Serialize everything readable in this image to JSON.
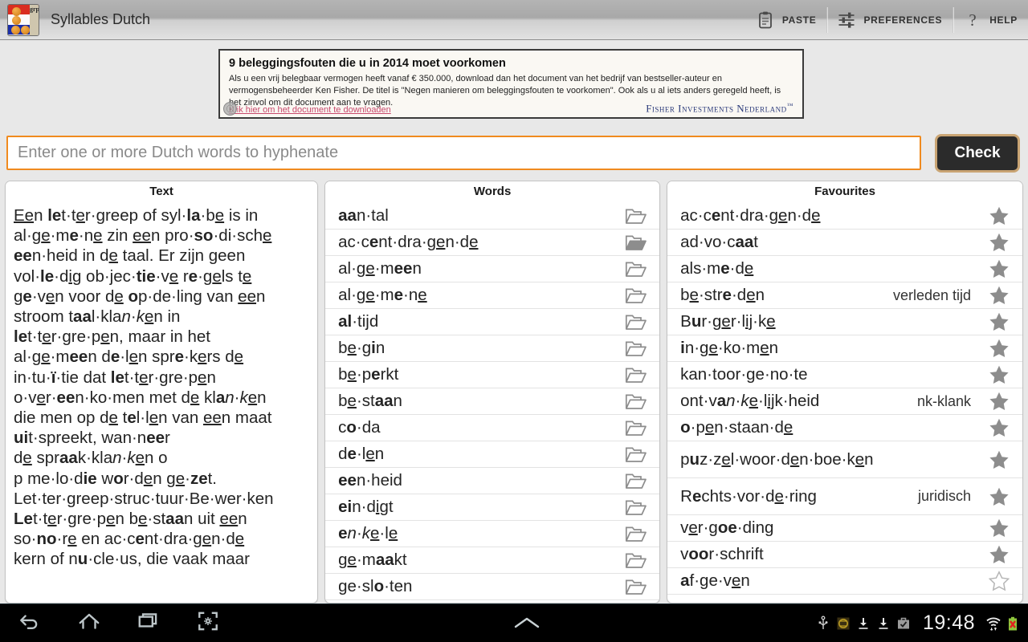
{
  "app": {
    "title": "Syllables Dutch",
    "logo_icon": "dutch-flag-balls-icon",
    "logo_letters": "grpn"
  },
  "actionbar": {
    "items": [
      {
        "label": "PASTE",
        "icon": "clipboard-paste-icon"
      },
      {
        "label": "PREFERENCES",
        "icon": "sliders-settings-icon"
      },
      {
        "label": "HELP",
        "icon": "question-mark-icon"
      }
    ]
  },
  "ad": {
    "title": "9 beleggingsfouten die u in 2014 moet voorkomen",
    "body": "Als u een vrij belegbaar vermogen heeft vanaf € 350.000, download dan het document van het bedrijf van bestseller-auteur en vermogensbeheerder Ken Fisher. De titel is \"Negen manieren om beleggingsfouten te voorkomen\". Ook als u al iets anders geregeld heeft, is het zinvol om dit document aan te vragen.",
    "link": "Klik hier om het document te downloaden",
    "brand": "Fisher Investments Nederland",
    "brand_tm": "™",
    "adchoices_icon": "adchoices-icon"
  },
  "search": {
    "placeholder": "Enter one or more Dutch words to hyphenate",
    "value": "",
    "accent_color": "#f08a1e"
  },
  "check_button": {
    "label": "Check"
  },
  "panels": {
    "text": {
      "title": "Text",
      "lines": [
        "<u>Ee</u>n <b>le</b>t·t<u>e</u>r·greep of syl·<b>la</b>·b<u>e</u> is in",
        "al·g<u>e</u>·m<b>e</b>·n<u>e</u> zin <u>ee</u>n pro·<b>so</b>·di·sch<u>e</u>",
        "<b>ee</b>n·heid in d<u>e</u> taal. Er zijn geen",
        "vol·<b>le</b>·d<u>i</u>g ob·jec·<b>tie</b>·v<u>e</u> r<b>e</b>·g<u>e</u>ls t<u>e</u>",
        "g<b>e</b>·v<u>e</u>n voor d<u>e</u> <b>o</b>p·de·ling van <u>ee</u>n",
        "stroom t<b>aa</b>l·kla<i>n</i>·<i>k</i><u>e</u>n in",
        "<b>le</b>t·t<u>e</u>r·gre·p<u>e</u>n, maar in het",
        "al·g<u>e</u>·m<b>ee</b>n d<b>e</b>·l<u>e</u>n spr<b>e</b>·k<u>e</u>rs d<u>e</u>",
        "in·tu·<b>ï</b>·tie dat <b>le</b>t·t<u>e</u>r·gre·p<u>e</u>n",
        "o·v<u>e</u>r·<b>ee</b>n·ko·men met d<u>e</u> kl<b>a</b><i>n</i>·<i>k</i><u>e</u>n",
        "die men op d<u>e</u> t<b>e</b>l·l<u>e</u>n van <u>ee</u>n maat",
        "<b>ui</b>t·spreekt, wan·n<b>ee</b>r",
        "d<u>e</u> spr<b>aa</b>k·kla<i>n</i>·<i>k</i><u>e</u>n o",
        "p me·lo·d<b>ie</b> w<b>o</b>r·d<u>e</u>n g<u>e</u>·<b>ze</b>t.",
        "Let·ter·greep·struc·tuur·Be·wer·ken",
        "<b>Le</b>t·t<u>e</u>r·gre·p<u>e</u>n b<u>e</u>·st<b>aa</b>n uit <u>ee</u>n",
        "so·<b>no</b>·r<u>e</u> en ac·c<b>e</b>nt·dra·g<u>e</u>n·d<u>e</u>",
        "kern of n<b>u</b>·cle·us, die vaak maar"
      ]
    },
    "words": {
      "title": "Words",
      "icon_open": "folder-open-icon",
      "icon_filled": "folder-filled-icon",
      "rows": [
        {
          "word": "<b>aa</b>n·tal",
          "icon": "folder-open-icon"
        },
        {
          "word": "ac·c<b>e</b>nt·dra·g<u>e</u>n·d<u>e</u>",
          "icon": "folder-filled-icon"
        },
        {
          "word": "al·g<u>e</u>·m<b>ee</b>n",
          "icon": "folder-open-icon"
        },
        {
          "word": "al·g<u>e</u>·m<b>e</b>·n<u>e</u>",
          "icon": "folder-open-icon"
        },
        {
          "word": "<b>al</b>·tijd",
          "icon": "folder-open-icon"
        },
        {
          "word": "b<u>e</u>·g<b>i</b>n",
          "icon": "folder-open-icon"
        },
        {
          "word": "b<u>e</u>·p<b>e</b>rkt",
          "icon": "folder-open-icon"
        },
        {
          "word": "b<u>e</u>·st<b>aa</b>n",
          "icon": "folder-open-icon"
        },
        {
          "word": "c<b>o</b>·da",
          "icon": "folder-open-icon"
        },
        {
          "word": "d<b>e</b>·l<u>e</u>n",
          "icon": "folder-open-icon"
        },
        {
          "word": "<b>ee</b>n·heid",
          "icon": "folder-open-icon"
        },
        {
          "word": "<b>ei</b>n·d<u>i</u>gt",
          "icon": "folder-open-icon"
        },
        {
          "word": "<b>e</b><i>n</i>·<i>k</i><u>e</u>·l<u>e</u>",
          "icon": "folder-open-icon"
        },
        {
          "word": "g<u>e</u>·m<b>aa</b>kt",
          "icon": "folder-open-icon"
        },
        {
          "word": "ge·sl<b>o</b>·ten",
          "icon": "folder-open-icon"
        }
      ]
    },
    "favourites": {
      "title": "Favourites",
      "rows": [
        {
          "word": "ac·c<b>e</b>nt·dra·g<u>e</u>n·d<u>e</u>",
          "note": "",
          "icon": "star-filled-icon",
          "tall": false
        },
        {
          "word": "ad·vo·c<b>aa</b>t",
          "note": "",
          "icon": "star-filled-icon",
          "tall": false
        },
        {
          "word": "als·m<b>e</b>·d<u>e</u>",
          "note": "",
          "icon": "star-filled-icon",
          "tall": false
        },
        {
          "word": "b<u>e</u>·str<b>e</b>·d<u>e</u>n",
          "note": "verleden tijd",
          "icon": "star-filled-icon",
          "tall": false
        },
        {
          "word": "B<b>u</b>r·g<u>e</u>r·l<u>ij</u>·k<u>e</u>",
          "note": "",
          "icon": "star-filled-icon",
          "tall": false
        },
        {
          "word": "<b>i</b>n·g<u>e</u>·ko·m<u>e</u>n",
          "note": "",
          "icon": "star-filled-icon",
          "tall": false
        },
        {
          "word": "kan·toor·ge·no·te",
          "note": "",
          "icon": "star-filled-icon",
          "tall": false
        },
        {
          "word": "ont·v<b>a</b><i>n</i>·<i>k</i><u>e</u>·l<u>ij</u>k·heid",
          "note": "nk-klank",
          "icon": "star-filled-icon",
          "tall": false
        },
        {
          "word": "<b>o</b>·p<u>e</u>n·staan·d<u>e</u>",
          "note": "",
          "icon": "star-filled-icon",
          "tall": false
        },
        {
          "word": "p<b>u</b>z·z<u>e</u>l·woor·d<u>e</u>n·boe·k<u>e</u>n",
          "note": "",
          "icon": "star-filled-icon",
          "tall": true
        },
        {
          "word": "R<b>e</b>chts·vor·d<u>e</u>·ring",
          "note": "juridisch",
          "icon": "star-filled-icon",
          "tall": true
        },
        {
          "word": "v<u>e</u>r·g<b>oe</b>·ding",
          "note": "",
          "icon": "star-filled-icon",
          "tall": false
        },
        {
          "word": "v<b>oo</b>r·schrift",
          "note": "",
          "icon": "star-filled-icon",
          "tall": false
        },
        {
          "word": "<b>a</b>f·ge·v<u>e</u>n",
          "note": "",
          "icon": "star-outline-icon",
          "tall": false
        }
      ]
    }
  },
  "navbar": {
    "buttons": [
      {
        "icon": "back-icon"
      },
      {
        "icon": "home-icon"
      },
      {
        "icon": "recents-icon"
      },
      {
        "icon": "screenshot-icon"
      }
    ],
    "status_icons": [
      "usb-icon",
      "app-notification-icon",
      "download-icon",
      "download-icon",
      "briefcase-check-icon"
    ],
    "clock": "19:48",
    "right_icons": [
      "wifi-icon",
      "battery-error-icon"
    ]
  }
}
